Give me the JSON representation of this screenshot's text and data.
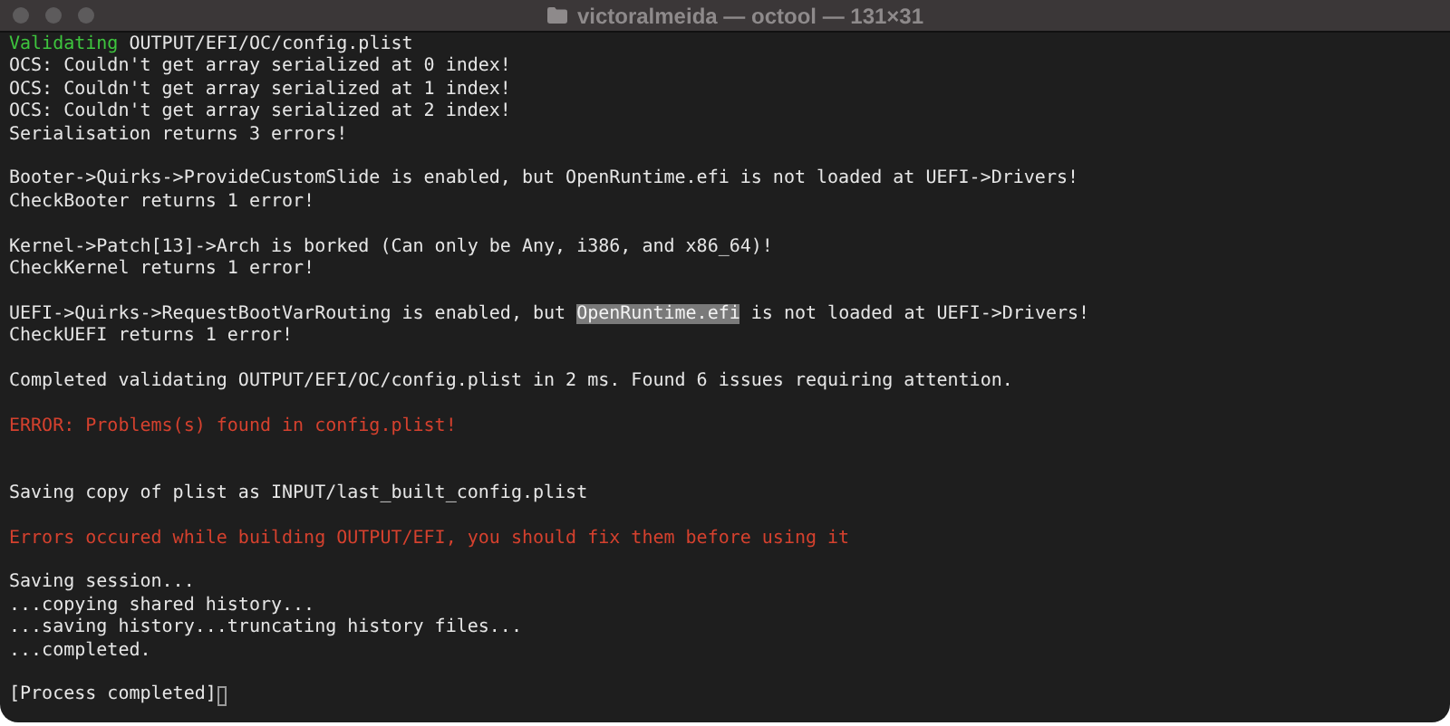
{
  "window": {
    "title": "victoralmeida — octool — 131×31"
  },
  "terminal": {
    "lines": [
      {
        "kind": "text",
        "segments": [
          {
            "text": "Validating",
            "kind": "success"
          },
          {
            "text": " OUTPUT/EFI/OC/config.plist",
            "kind": "normal"
          }
        ]
      },
      {
        "kind": "text",
        "segments": [
          {
            "text": "OCS: Couldn't get array serialized at 0 index!",
            "kind": "normal"
          }
        ]
      },
      {
        "kind": "text",
        "segments": [
          {
            "text": "OCS: Couldn't get array serialized at 1 index!",
            "kind": "normal"
          }
        ]
      },
      {
        "kind": "text",
        "segments": [
          {
            "text": "OCS: Couldn't get array serialized at 2 index!",
            "kind": "normal"
          }
        ]
      },
      {
        "kind": "text",
        "segments": [
          {
            "text": "Serialisation returns 3 errors!",
            "kind": "normal"
          }
        ]
      },
      {
        "kind": "blank"
      },
      {
        "kind": "text",
        "segments": [
          {
            "text": "Booter->Quirks->ProvideCustomSlide is enabled, but OpenRuntime.efi is not loaded at UEFI->Drivers!",
            "kind": "normal"
          }
        ]
      },
      {
        "kind": "text",
        "segments": [
          {
            "text": "CheckBooter returns 1 error!",
            "kind": "normal"
          }
        ]
      },
      {
        "kind": "blank"
      },
      {
        "kind": "text",
        "segments": [
          {
            "text": "Kernel->Patch[13]->Arch is borked (Can only be Any, i386, and x86_64)!",
            "kind": "normal"
          }
        ]
      },
      {
        "kind": "text",
        "segments": [
          {
            "text": "CheckKernel returns 1 error!",
            "kind": "normal"
          }
        ]
      },
      {
        "kind": "blank"
      },
      {
        "kind": "text",
        "segments": [
          {
            "text": "UEFI->Quirks->RequestBootVarRouting is enabled, but ",
            "kind": "normal"
          },
          {
            "text": "OpenRuntime.efi",
            "kind": "normal",
            "selected": true
          },
          {
            "text": " is not loaded at UEFI->Drivers!",
            "kind": "normal"
          }
        ]
      },
      {
        "kind": "text",
        "segments": [
          {
            "text": "CheckUEFI returns 1 error!",
            "kind": "normal"
          }
        ]
      },
      {
        "kind": "blank"
      },
      {
        "kind": "text",
        "segments": [
          {
            "text": "Completed validating OUTPUT/EFI/OC/config.plist in 2 ms. Found 6 issues requiring attention.",
            "kind": "normal"
          }
        ]
      },
      {
        "kind": "blank"
      },
      {
        "kind": "text",
        "segments": [
          {
            "text": "ERROR: Problems(s) found in config.plist!",
            "kind": "error"
          }
        ]
      },
      {
        "kind": "blank"
      },
      {
        "kind": "blank"
      },
      {
        "kind": "text",
        "segments": [
          {
            "text": "Saving copy of plist as INPUT/last_built_config.plist",
            "kind": "normal"
          }
        ]
      },
      {
        "kind": "blank"
      },
      {
        "kind": "text",
        "segments": [
          {
            "text": "Errors occured while building OUTPUT/EFI, you should fix them before using it",
            "kind": "error"
          }
        ]
      },
      {
        "kind": "blank"
      },
      {
        "kind": "text",
        "segments": [
          {
            "text": "Saving session...",
            "kind": "normal"
          }
        ]
      },
      {
        "kind": "text",
        "segments": [
          {
            "text": "...copying shared history...",
            "kind": "normal"
          }
        ]
      },
      {
        "kind": "text",
        "segments": [
          {
            "text": "...saving history...truncating history files...",
            "kind": "normal"
          }
        ]
      },
      {
        "kind": "text",
        "segments": [
          {
            "text": "...completed.",
            "kind": "normal"
          }
        ]
      },
      {
        "kind": "blank"
      },
      {
        "kind": "prompt",
        "segments": [
          {
            "text": "[Process completed]",
            "kind": "normal"
          }
        ]
      }
    ]
  }
}
